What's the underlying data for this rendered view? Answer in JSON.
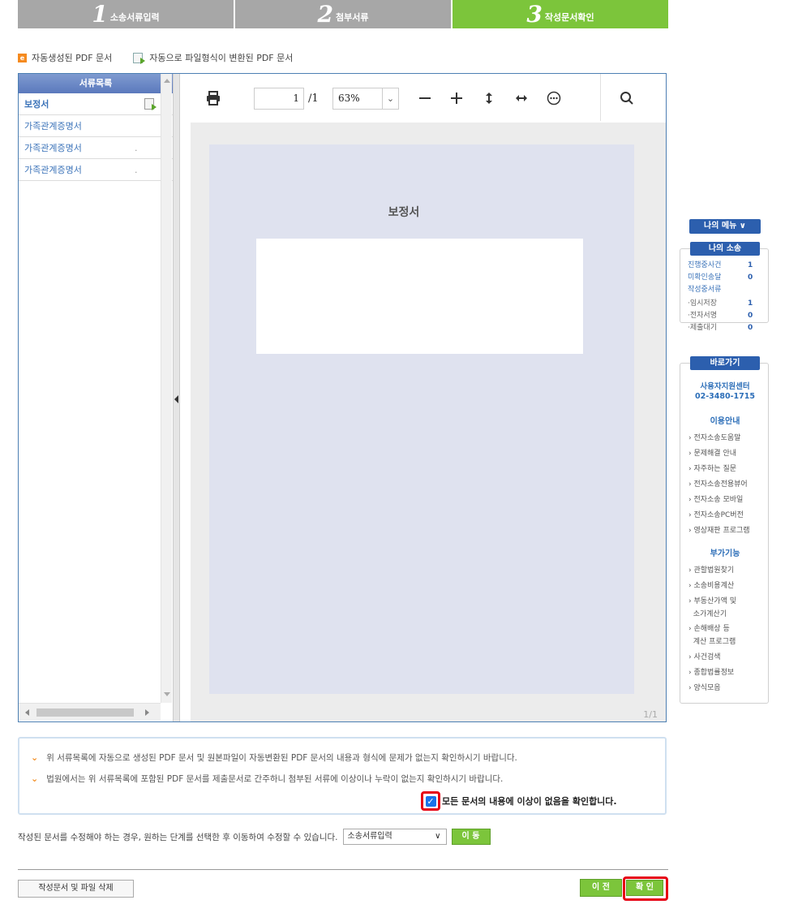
{
  "steps": [
    {
      "num": "1",
      "label": "소송서류입력"
    },
    {
      "num": "2",
      "label": "첨부서류"
    },
    {
      "num": "3",
      "label": "작성문서확인"
    }
  ],
  "legend": {
    "auto_pdf": "자동생성된 PDF 문서",
    "converted_pdf": "자동으로 파일형식이 변환된 PDF 문서",
    "auto_pdf_badge": "e"
  },
  "doc_list": {
    "header": "서류목록",
    "items": [
      {
        "label": "보정서",
        "selected": true
      },
      {
        "label": "가족관계증명서",
        "dot": ""
      },
      {
        "label": "가족관계증명서",
        "dot": "."
      },
      {
        "label": "가족관계증명서",
        "dot": "."
      }
    ]
  },
  "viewer": {
    "page_current": "1",
    "page_total": "/1",
    "zoom": "63%",
    "page_title": "보정서",
    "page_count": "1/1"
  },
  "side": {
    "menu_label": "나의 메뉴 ∨",
    "my_suit": {
      "title": "나의 소송",
      "rows": [
        {
          "label": "진행중사건",
          "value": "1",
          "style": "link"
        },
        {
          "label": "미확인송달",
          "value": "0",
          "style": "link"
        },
        {
          "label": "작성중서류",
          "value": "",
          "style": "link"
        },
        {
          "label": "·임시저장",
          "value": "1",
          "style": "grey"
        },
        {
          "label": "·전자서명",
          "value": "0",
          "style": "grey"
        },
        {
          "label": "·제출대기",
          "value": "0",
          "style": "grey"
        }
      ]
    },
    "shortcut": {
      "title": "바로가기",
      "center_name": "사용자지원센터",
      "center_phone": "02-3480-1715",
      "guide_head": "이용안내",
      "guide_links": [
        "› 전자소송도움말",
        "› 문제해결 안내",
        "› 자주하는 질문",
        "› 전자소송전용뷰어",
        "› 전자소송 모바일",
        "› 전자소송PC버전",
        "› 영상재판 프로그램"
      ],
      "extra_head": "부가기능",
      "extra_links": [
        "› 관할법원찾기",
        "› 소송비용계산",
        "› 부동산가액 및",
        "  소가계산기",
        "› 손해배상 등",
        "  계산 프로그램",
        "› 사건검색",
        "› 종합법률정보",
        "› 양식모음"
      ]
    }
  },
  "info": {
    "line1": "위 서류목록에 자동으로 생성된 PDF 문서 및 원본파일이 자동변환된 PDF 문서의 내용과 형식에 문제가 없는지 확인하시기 바랍니다.",
    "line2": "법원에서는 위 서류목록에 포함된 PDF 문서를 제출문서로 간주하니 첨부된 서류에 이상이나 누락이 없는지 확인하시기 바랍니다.",
    "confirm_label": "모든 문서의 내용에 이상이 없음을 확인합니다.",
    "confirm_checked": true
  },
  "move": {
    "text": "작성된 문서를 수정해야 하는 경우, 원하는 단계를 선택한 후 이동하여 수정할 수 있습니다.",
    "select_value": "소송서류입력",
    "button": "이 동"
  },
  "footer": {
    "delete_button": "작성문서 및 파일 삭제",
    "prev_button": "이 전",
    "ok_button": "확 인"
  },
  "colors": {
    "step_active": "#7cc53b",
    "step_inactive": "#a7a7a7",
    "accent_blue": "#2c5fae",
    "highlight_red": "#e60012"
  }
}
